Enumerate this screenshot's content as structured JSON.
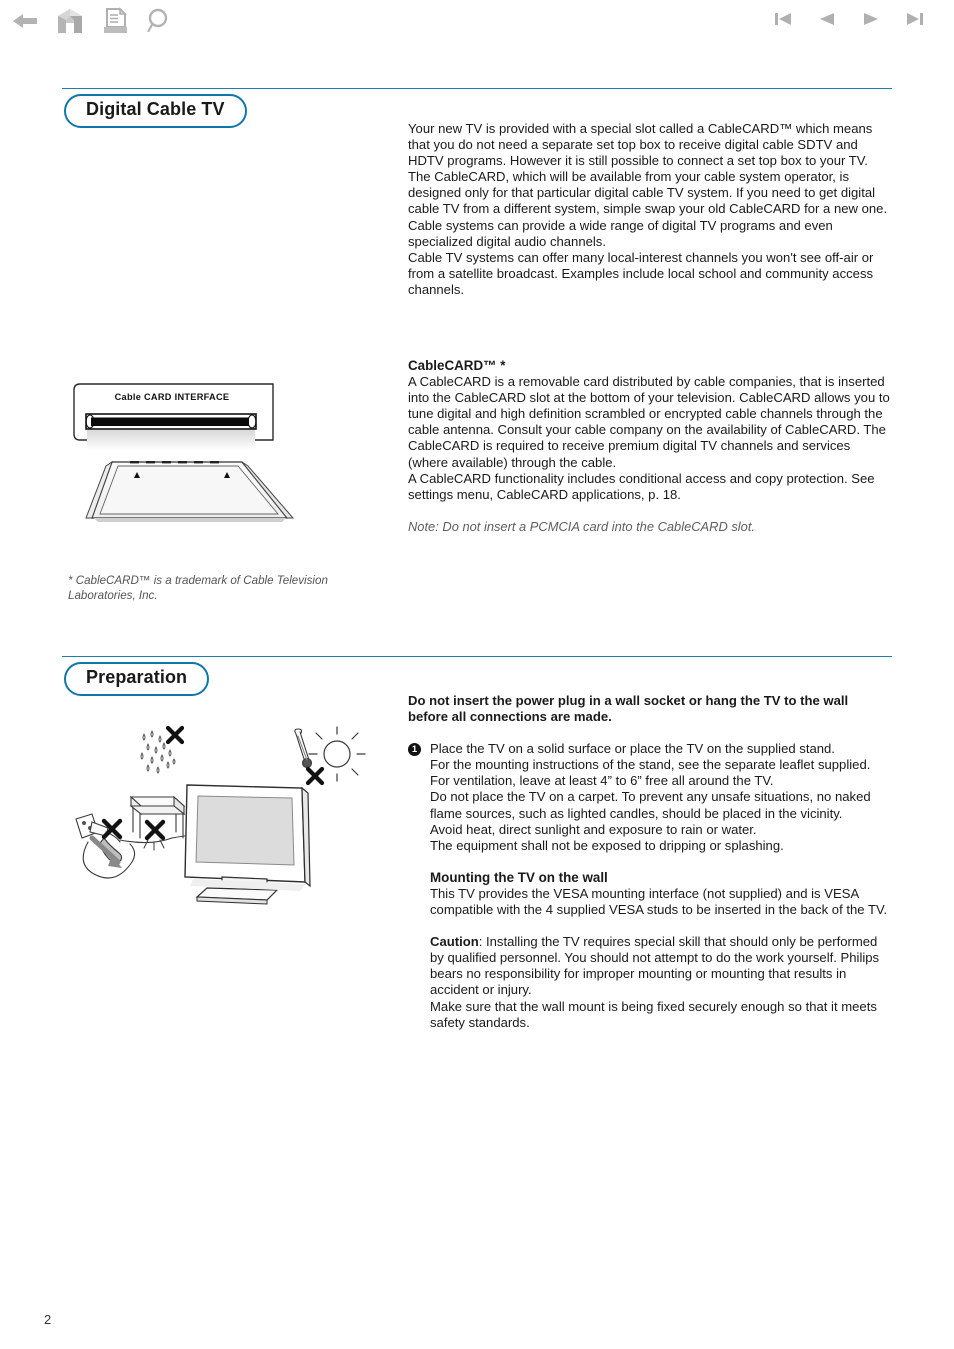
{
  "toolbar": {
    "left_icons": [
      {
        "name": "back-arrow-icon",
        "label": "Back"
      },
      {
        "name": "home-icon",
        "label": "Home"
      },
      {
        "name": "print-document-icon",
        "label": "Print"
      },
      {
        "name": "search-icon",
        "label": "Search"
      }
    ],
    "right_icons": [
      {
        "name": "first-page-icon",
        "label": "First page"
      },
      {
        "name": "previous-page-icon",
        "label": "Previous page"
      },
      {
        "name": "next-page-icon",
        "label": "Next page"
      },
      {
        "name": "last-page-icon",
        "label": "Last page"
      }
    ]
  },
  "colors": {
    "accent_blue": "#0f76ab",
    "rule_blue": "#1c7fb0",
    "text": "#1a1a1a",
    "muted": "#5e5e5e",
    "toolbar_icon": "#b0b0b0"
  },
  "sections": {
    "digital_cable_tv": {
      "heading": "Digital Cable TV",
      "intro_paragraph_1": "Your new TV is provided with a special slot called a CableCARD™ which means  that you do not need a separate set top box to receive digital cable SDTV and HDTV programs. However it is still possible to connect a set top box to your TV.",
      "intro_paragraph_2": "The CableCARD, which will be available from your cable system operator, is designed only for that particular digital cable TV system. If you need to get digital cable TV from a different system, simple swap your old CableCARD for a new one.",
      "intro_paragraph_3": "Cable systems can provide a wide range of digital TV programs and even specialized digital audio channels.",
      "intro_paragraph_4": "Cable TV systems can offer many local-interest channels you won't see off-air or from a satellite broadcast. Examples include local school and community access channels.",
      "subheading": "CableCARD™ *",
      "body_paragraph_1": "A CableCARD is a removable card distributed by cable companies, that is inserted into the CableCARD slot at the bottom of your television. CableCARD allows you to tune digital and high definition scrambled or encrypted cable channels through the cable antenna. Consult your cable company on the availability of CableCARD. The CableCARD is required to receive premium digital TV channels and services (where available) through the cable.",
      "body_paragraph_2": "A CableCARD functionality includes conditional access and copy protection. See settings menu, CableCARD applications, p. 18.",
      "note": "Note: Do not insert a PCMCIA card into the CableCARD slot.",
      "illustration_label": "Cable CARD INTERFACE",
      "footnote": "* CableCARD™ is a trademark of Cable Television Laboratories, Inc."
    },
    "preparation": {
      "heading": "Preparation",
      "warning": "Do not insert the power plug in a wall socket or hang the TV to the wall before all connections are made.",
      "step_number": "1",
      "step_lines": [
        "Place the TV on a solid surface or place the TV on the supplied stand.",
        "For the mounting instructions of the stand, see the separate leaflet supplied.",
        "For ventilation, leave at least 4” to 6” free all around the TV.",
        "Do not place the TV on a carpet. To prevent any unsafe situations, no naked flame sources, such as lighted candles, should be placed in the vicinity.",
        "Avoid heat, direct sunlight and exposure to rain or water.",
        "The equipment shall not be exposed to dripping or splashing."
      ],
      "mounting_subheading": "Mounting the TV on the wall",
      "mounting_paragraph": "This TV provides the VESA mounting interface (not supplied) and is VESA compatible with the 4 supplied VESA studs to be inserted in the back of the TV.",
      "caution_label": "Caution",
      "caution_paragraph": ": Installing the TV requires special skill that should only be performed by qualified personnel. You should not attempt to do the work yourself. Philips bears no responsibility for improper mounting or mounting that results in accident or injury.",
      "caution_extra": "Make sure that the wall mount is being fixed securely enough so that it meets safety standards."
    }
  },
  "footer": {
    "page_number": "2"
  }
}
